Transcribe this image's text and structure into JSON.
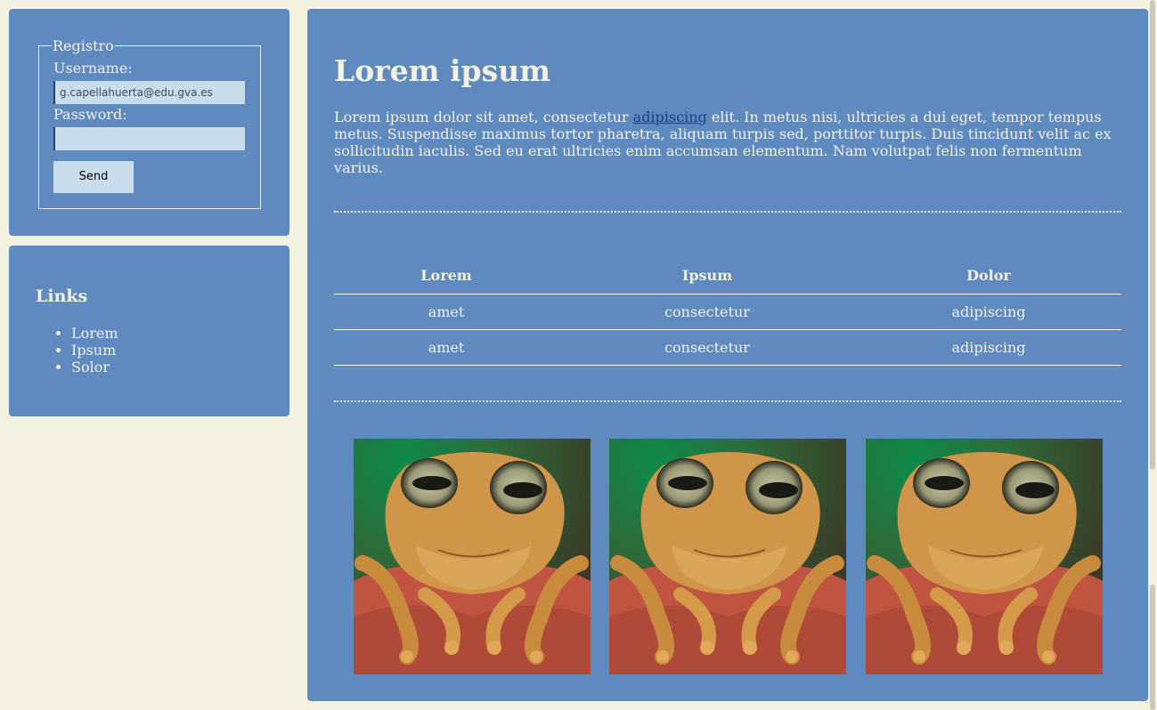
{
  "login": {
    "legend": "Registro",
    "username_label": "Username:",
    "username_value": "g.capellahuerta@edu.gva.es",
    "password_label": "Password:",
    "password_value": "",
    "send_label": "Send"
  },
  "links": {
    "title": "Links",
    "items": [
      "Lorem",
      "Ipsum",
      "Solor"
    ]
  },
  "main": {
    "title": "Lorem ipsum",
    "intro_before": "Lorem ipsum dolor sit amet, consectetur ",
    "intro_link": "adipiscing",
    "intro_after": " elit. In metus nisi, ultricies a dui eget, tempor tempus metus. Suspendisse maximus tortor pharetra, aliquam turpis sed, porttitor turpis. Duis tincidunt velit ac ex sollicitudin iaculis. Sed eu erat ultricies enim accumsan elementum. Nam volutpat felis non fermentum varius.",
    "table": {
      "headers": [
        "Lorem",
        "Ipsum",
        "Dolor"
      ],
      "rows": [
        [
          "amet",
          "consectetur",
          "adipiscing"
        ],
        [
          "amet",
          "consectetur",
          "adipiscing"
        ]
      ]
    }
  },
  "colors": {
    "page_bg": "#f3f1e0",
    "panel_bg": "#5f8abf",
    "input_bg": "#c9dcec",
    "link": "#1f3f8a"
  },
  "images": [
    "frog-icon",
    "frog-icon",
    "frog-icon"
  ]
}
